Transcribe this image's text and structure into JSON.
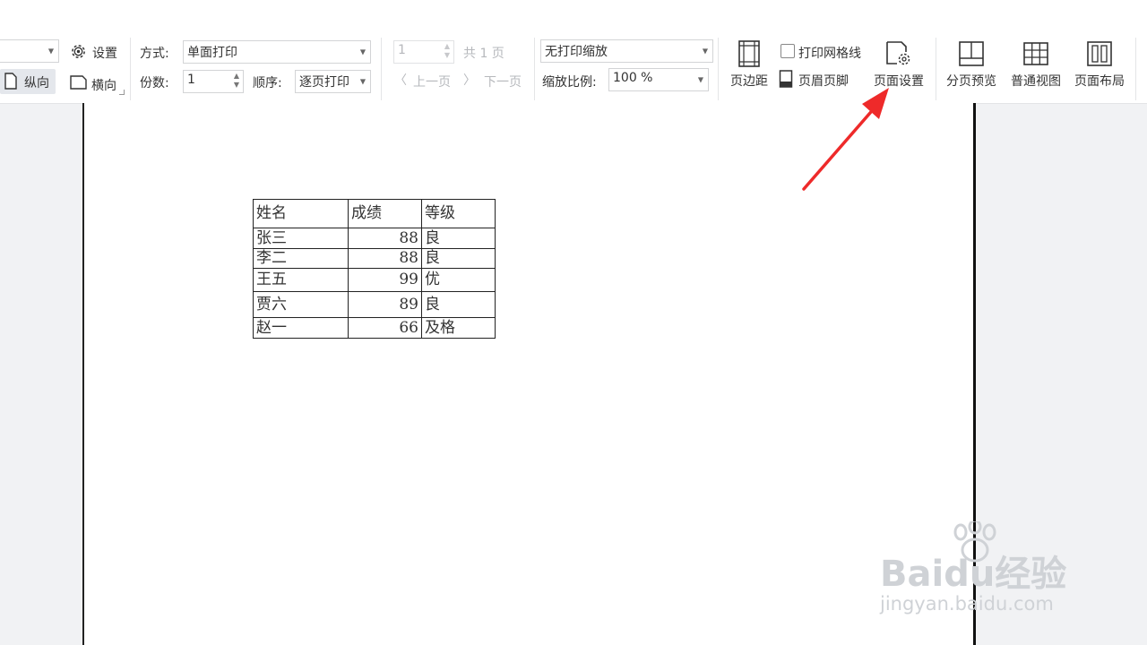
{
  "toolbar": {
    "orientation": {
      "settings_label": "设置",
      "portrait_label": "纵向",
      "landscape_label": "横向"
    },
    "print": {
      "method_label": "方式:",
      "method_value": "单面打印",
      "copies_label": "份数:",
      "copies_value": "1",
      "order_label": "顺序:",
      "order_value": "逐页打印"
    },
    "pages": {
      "page_value": "1",
      "total_label": "共 1 页",
      "prev_label": "上一页",
      "next_label": "下一页"
    },
    "scale": {
      "mode_value": "无打印缩放",
      "ratio_label": "缩放比例:",
      "ratio_value": "100 %"
    },
    "layout": {
      "margins_label": "页边距",
      "gridlines_label": "打印网格线",
      "header_footer_label": "页眉页脚",
      "page_setup_label": "页面设置"
    },
    "views": {
      "page_break_label": "分页预览",
      "normal_label": "普通视图",
      "page_layout_label": "页面布局"
    }
  },
  "table": {
    "headers": [
      "姓名",
      "成绩",
      "等级"
    ],
    "rows": [
      [
        "张三",
        "88",
        "良"
      ],
      [
        "李二",
        "88",
        "良"
      ],
      [
        "王五",
        "99",
        "优"
      ],
      [
        "贾六",
        "89",
        "良"
      ],
      [
        "赵一",
        "66",
        "及格"
      ]
    ]
  },
  "watermark": {
    "brand": "Baidu经验",
    "url": "jingyan.baidu.com"
  },
  "colors": {
    "annotation_arrow": "#ee2a2a",
    "toolbar_bg": "#ffffff",
    "workspace_bg": "#f1f2f4",
    "selected_button_bg": "#e4e7ec"
  }
}
